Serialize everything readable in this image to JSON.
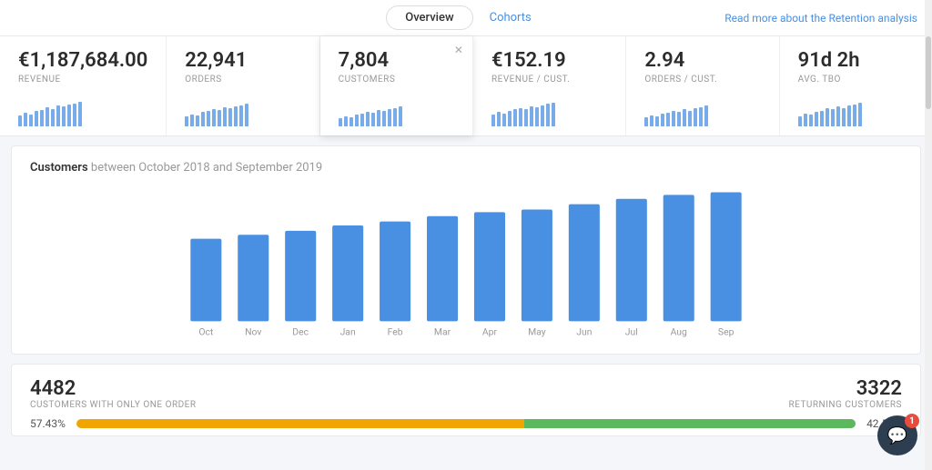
{
  "nav": {
    "tab_overview": "Overview",
    "tab_cohorts": "Cohorts",
    "read_more": "Read more about the Retention analysis"
  },
  "metrics": [
    {
      "value": "€1,187,684.00",
      "label": "REVENUE",
      "bars": [
        20,
        25,
        22,
        28,
        30,
        35,
        32,
        38,
        36,
        40,
        42,
        45
      ]
    },
    {
      "value": "22,941",
      "label": "ORDERS",
      "bars": [
        18,
        22,
        20,
        26,
        28,
        32,
        30,
        35,
        33,
        37,
        39,
        42
      ]
    },
    {
      "value": "7,804",
      "label": "CUSTOMERS",
      "bars": [
        15,
        19,
        17,
        22,
        24,
        27,
        25,
        30,
        28,
        32,
        34,
        36
      ],
      "active": true,
      "show_close": true
    },
    {
      "value": "€152.19",
      "label": "REVENUE / CUST.",
      "bars": [
        22,
        26,
        23,
        29,
        31,
        34,
        32,
        37,
        35,
        39,
        41,
        44
      ]
    },
    {
      "value": "2.94",
      "label": "ORDERS / CUST.",
      "bars": [
        16,
        20,
        18,
        23,
        25,
        28,
        26,
        31,
        29,
        33,
        35,
        38
      ]
    },
    {
      "value": "91d 2h",
      "label": "AVG. TBO",
      "bars": [
        19,
        23,
        21,
        27,
        29,
        33,
        31,
        36,
        34,
        38,
        40,
        43
      ]
    }
  ],
  "chart": {
    "title_bold": "Customers",
    "title_rest": " between October 2018 and September 2019",
    "months": [
      "Oct",
      "Nov",
      "Dec",
      "Jan",
      "Feb",
      "Mar",
      "Apr",
      "May",
      "Jun",
      "Jul",
      "Aug",
      "Sep"
    ],
    "values": [
      62,
      65,
      68,
      72,
      75,
      79,
      82,
      84,
      88,
      92,
      95,
      97
    ],
    "bar_color": "#4a90e2"
  },
  "bottom": {
    "left_value": "4482",
    "left_label": "CUSTOMERS WITH ONLY ONE ORDER",
    "right_value": "3322",
    "right_label": "RETURNING CUSTOMERS",
    "pct_left": "57.43%",
    "pct_right": "42.57%",
    "pct_left_num": 57.43
  },
  "chat": {
    "badge": "1"
  }
}
